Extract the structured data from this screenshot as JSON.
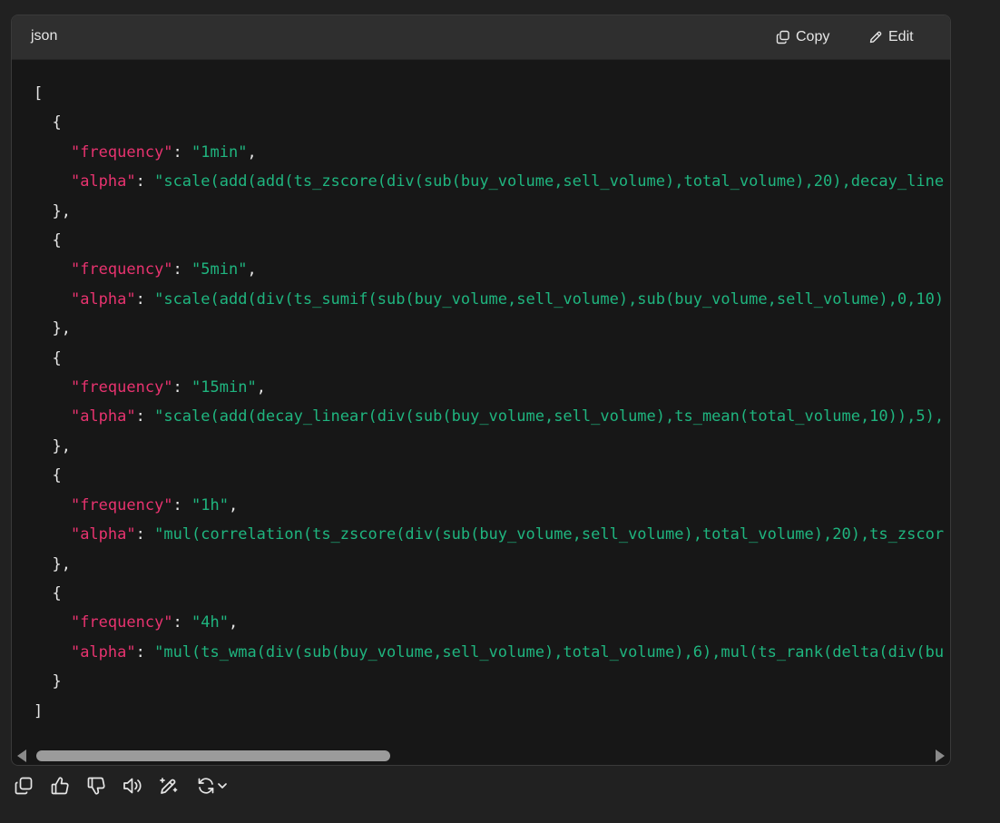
{
  "code_block": {
    "language": "json",
    "copy_label": "Copy",
    "edit_label": "Edit",
    "lines": [
      [
        {
          "t": "p",
          "v": "["
        }
      ],
      [
        {
          "t": "p",
          "v": "  {"
        }
      ],
      [
        {
          "t": "p",
          "v": "    "
        },
        {
          "t": "k",
          "v": "\"frequency\""
        },
        {
          "t": "p",
          "v": ": "
        },
        {
          "t": "s",
          "v": "\"1min\""
        },
        {
          "t": "p",
          "v": ","
        }
      ],
      [
        {
          "t": "p",
          "v": "    "
        },
        {
          "t": "k",
          "v": "\"alpha\""
        },
        {
          "t": "p",
          "v": ": "
        },
        {
          "t": "s",
          "v": "\"scale(add(add(ts_zscore(div(sub(buy_volume,sell_volume),total_volume),20),decay_line"
        }
      ],
      [
        {
          "t": "p",
          "v": "  },"
        }
      ],
      [
        {
          "t": "p",
          "v": "  {"
        }
      ],
      [
        {
          "t": "p",
          "v": "    "
        },
        {
          "t": "k",
          "v": "\"frequency\""
        },
        {
          "t": "p",
          "v": ": "
        },
        {
          "t": "s",
          "v": "\"5min\""
        },
        {
          "t": "p",
          "v": ","
        }
      ],
      [
        {
          "t": "p",
          "v": "    "
        },
        {
          "t": "k",
          "v": "\"alpha\""
        },
        {
          "t": "p",
          "v": ": "
        },
        {
          "t": "s",
          "v": "\"scale(add(div(ts_sumif(sub(buy_volume,sell_volume),sub(buy_volume,sell_volume),0,10)"
        }
      ],
      [
        {
          "t": "p",
          "v": "  },"
        }
      ],
      [
        {
          "t": "p",
          "v": "  {"
        }
      ],
      [
        {
          "t": "p",
          "v": "    "
        },
        {
          "t": "k",
          "v": "\"frequency\""
        },
        {
          "t": "p",
          "v": ": "
        },
        {
          "t": "s",
          "v": "\"15min\""
        },
        {
          "t": "p",
          "v": ","
        }
      ],
      [
        {
          "t": "p",
          "v": "    "
        },
        {
          "t": "k",
          "v": "\"alpha\""
        },
        {
          "t": "p",
          "v": ": "
        },
        {
          "t": "s",
          "v": "\"scale(add(decay_linear(div(sub(buy_volume,sell_volume),ts_mean(total_volume,10)),5),"
        }
      ],
      [
        {
          "t": "p",
          "v": "  },"
        }
      ],
      [
        {
          "t": "p",
          "v": "  {"
        }
      ],
      [
        {
          "t": "p",
          "v": "    "
        },
        {
          "t": "k",
          "v": "\"frequency\""
        },
        {
          "t": "p",
          "v": ": "
        },
        {
          "t": "s",
          "v": "\"1h\""
        },
        {
          "t": "p",
          "v": ","
        }
      ],
      [
        {
          "t": "p",
          "v": "    "
        },
        {
          "t": "k",
          "v": "\"alpha\""
        },
        {
          "t": "p",
          "v": ": "
        },
        {
          "t": "s",
          "v": "\"mul(correlation(ts_zscore(div(sub(buy_volume,sell_volume),total_volume),20),ts_zscor"
        }
      ],
      [
        {
          "t": "p",
          "v": "  },"
        }
      ],
      [
        {
          "t": "p",
          "v": "  {"
        }
      ],
      [
        {
          "t": "p",
          "v": "    "
        },
        {
          "t": "k",
          "v": "\"frequency\""
        },
        {
          "t": "p",
          "v": ": "
        },
        {
          "t": "s",
          "v": "\"4h\""
        },
        {
          "t": "p",
          "v": ","
        }
      ],
      [
        {
          "t": "p",
          "v": "    "
        },
        {
          "t": "k",
          "v": "\"alpha\""
        },
        {
          "t": "p",
          "v": ": "
        },
        {
          "t": "s",
          "v": "\"mul(ts_wma(div(sub(buy_volume,sell_volume),total_volume),6),mul(ts_rank(delta(div(bu"
        }
      ],
      [
        {
          "t": "p",
          "v": "  }"
        }
      ],
      [
        {
          "t": "p",
          "v": "]"
        }
      ]
    ]
  },
  "icons": {
    "copy": "copy-icon",
    "edit": "pencil-icon",
    "actions": [
      "copy-icon",
      "thumbs-up-icon",
      "thumbs-down-icon",
      "speaker-icon",
      "edit-sparkle-icon",
      "regenerate-icon",
      "chevron-down-icon"
    ]
  },
  "colors": {
    "key": "#e8336f",
    "string": "#1fb57f",
    "text": "#e6e6e6",
    "background": "#171717"
  }
}
